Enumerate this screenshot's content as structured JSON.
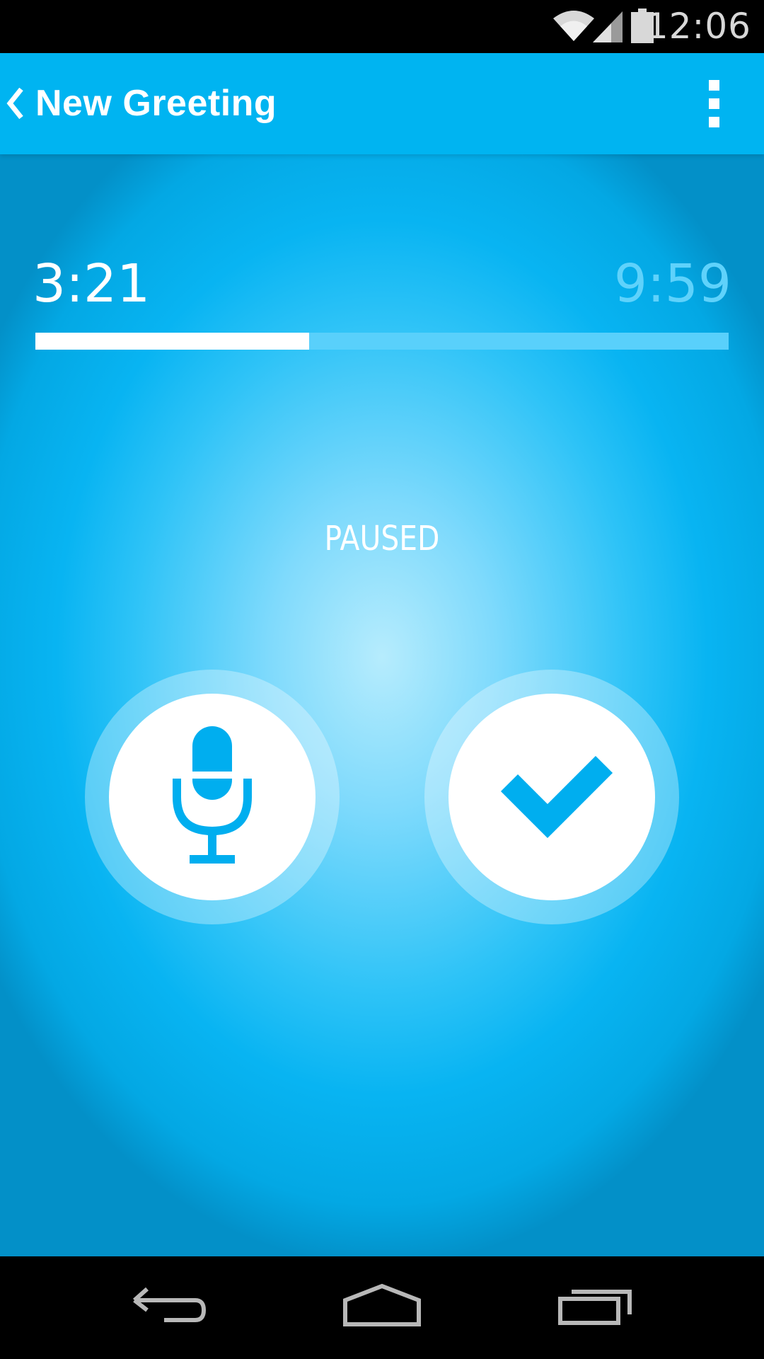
{
  "status_bar": {
    "time": "12:06",
    "icons": [
      "wifi-icon",
      "signal-icon",
      "battery-icon"
    ]
  },
  "app_bar": {
    "title": "New Greeting",
    "back_icon": "chevron-left-icon",
    "menu_icon": "overflow-menu-icon"
  },
  "recorder": {
    "elapsed": "3:21",
    "max": "9:59",
    "progress": 0.395,
    "status": "PAUSED",
    "record_icon": "microphone-icon",
    "done_icon": "checkmark-icon"
  },
  "nav_bar": {
    "icons": [
      "back-arrow-icon",
      "home-icon",
      "recents-icon"
    ]
  },
  "colors": {
    "accent": "#00b4f1",
    "icon_blue": "#00aeef",
    "max_time": "#5fd2fb",
    "track": "#59d0fb"
  }
}
